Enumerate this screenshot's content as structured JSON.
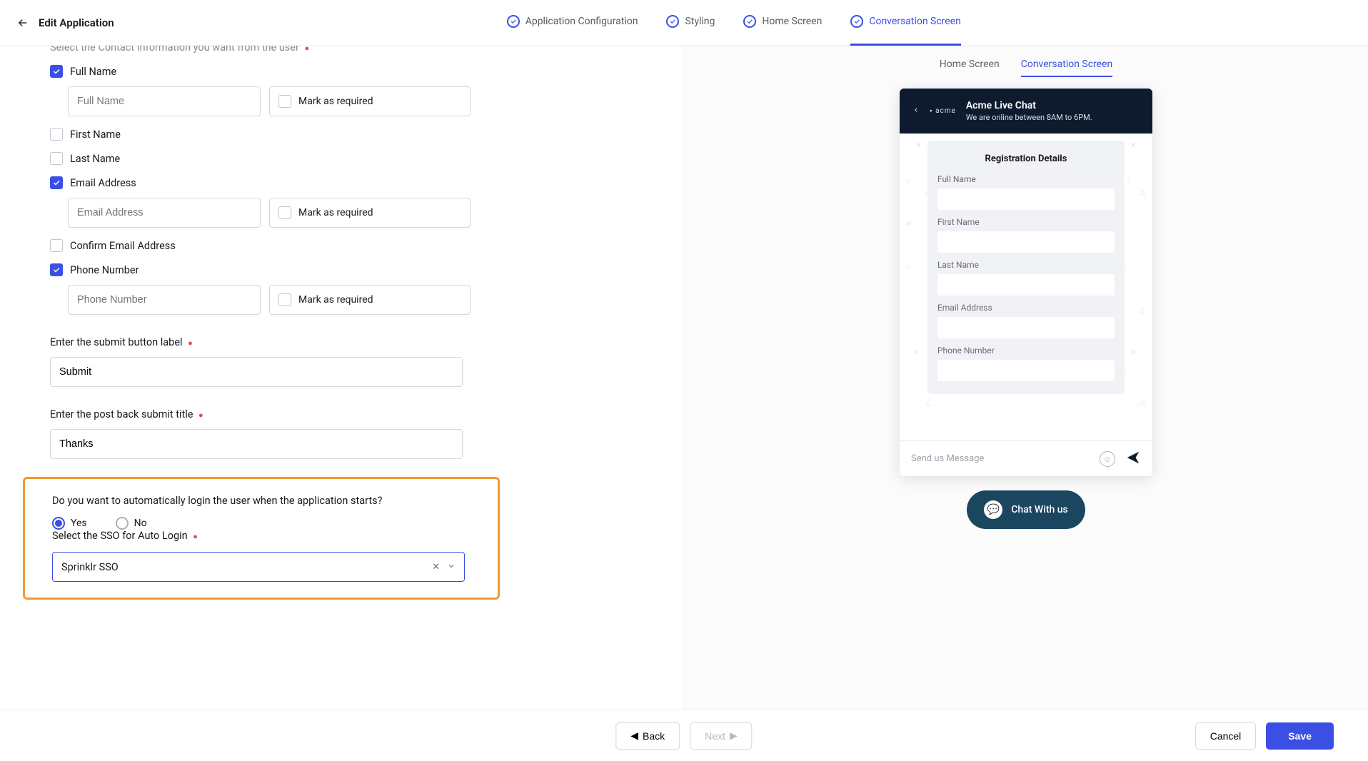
{
  "header": {
    "title": "Edit Application",
    "tabs": [
      {
        "label": "Application Configuration",
        "active": false
      },
      {
        "label": "Styling",
        "active": false
      },
      {
        "label": "Home Screen",
        "active": false
      },
      {
        "label": "Conversation Screen",
        "active": true
      }
    ]
  },
  "form": {
    "contact_info_truncated": "Select the Contact Information you want from the user",
    "full_name": {
      "checked": true,
      "label": "Full Name",
      "placeholder": "Full Name",
      "mark_label": "Mark as required"
    },
    "first_name": {
      "checked": false,
      "label": "First Name"
    },
    "last_name": {
      "checked": false,
      "label": "Last Name"
    },
    "email": {
      "checked": true,
      "label": "Email Address",
      "placeholder": "Email Address",
      "mark_label": "Mark as required"
    },
    "confirm_email": {
      "checked": false,
      "label": "Confirm Email Address"
    },
    "phone": {
      "checked": true,
      "label": "Phone Number",
      "placeholder": "Phone Number",
      "mark_label": "Mark as required"
    },
    "submit_label_title": "Enter the submit button label",
    "submit_label_value": "Submit",
    "postback_title": "Enter the post back submit title",
    "postback_value": "Thanks",
    "auto_login_q": "Do you want to automatically login the user when the application starts?",
    "opt_yes": "Yes",
    "opt_no": "No",
    "sso_label": "Select the SSO for Auto Login",
    "sso_value": "Sprinklr SSO"
  },
  "preview": {
    "tabs": {
      "home": "Home Screen",
      "conv": "Conversation Screen"
    },
    "logo": "⬩ acme",
    "title": "Acme Live Chat",
    "subtitle": "We are online between 8AM to 6PM.",
    "reg_title": "Registration Details",
    "fields": {
      "full": "Full Name",
      "first": "First Name",
      "last": "Last Name",
      "email": "Email Address",
      "phone": "Phone Number"
    },
    "input_placeholder": "Send us Message",
    "chat_pill": "Chat With us"
  },
  "footer": {
    "back": "Back",
    "next": "Next",
    "cancel": "Cancel",
    "save": "Save"
  }
}
